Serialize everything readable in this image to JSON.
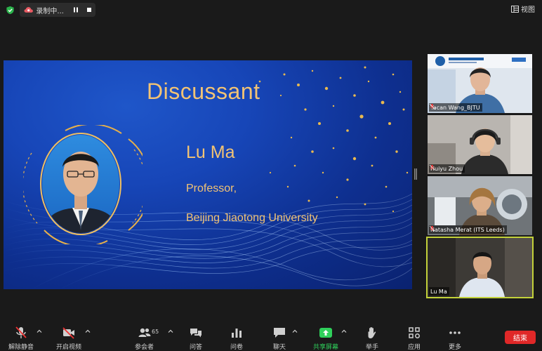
{
  "top": {
    "recording_label": "录制中...",
    "view_label": "视图"
  },
  "slide": {
    "title": "Discussant",
    "name": "Lu Ma",
    "role": "Professor,",
    "affiliation": "Beijing Jiaotong University"
  },
  "participants": [
    {
      "name": "Yacan Wang_BJTU",
      "muted": true
    },
    {
      "name": "Huiyu Zhou",
      "muted": true
    },
    {
      "name": "Natasha Merat (ITS Leeds)",
      "muted": true
    },
    {
      "name": "Lu Ma",
      "muted": false,
      "active": true
    }
  ],
  "toolbar": {
    "unmute_label": "解除静音",
    "video_label": "开启视频",
    "participants_label": "参会者",
    "participants_count": "65",
    "qa_label": "问答",
    "poll_label": "问卷",
    "chat_label": "聊天",
    "share_label": "共享屏幕",
    "raise_hand_label": "举手",
    "apps_label": "应用",
    "more_label": "更多",
    "end_label": "结束"
  },
  "colors": {
    "accent_gold": "#f2c374",
    "share_green": "#2fd05b",
    "end_red": "#e02828",
    "active_border": "#c3d23a"
  }
}
